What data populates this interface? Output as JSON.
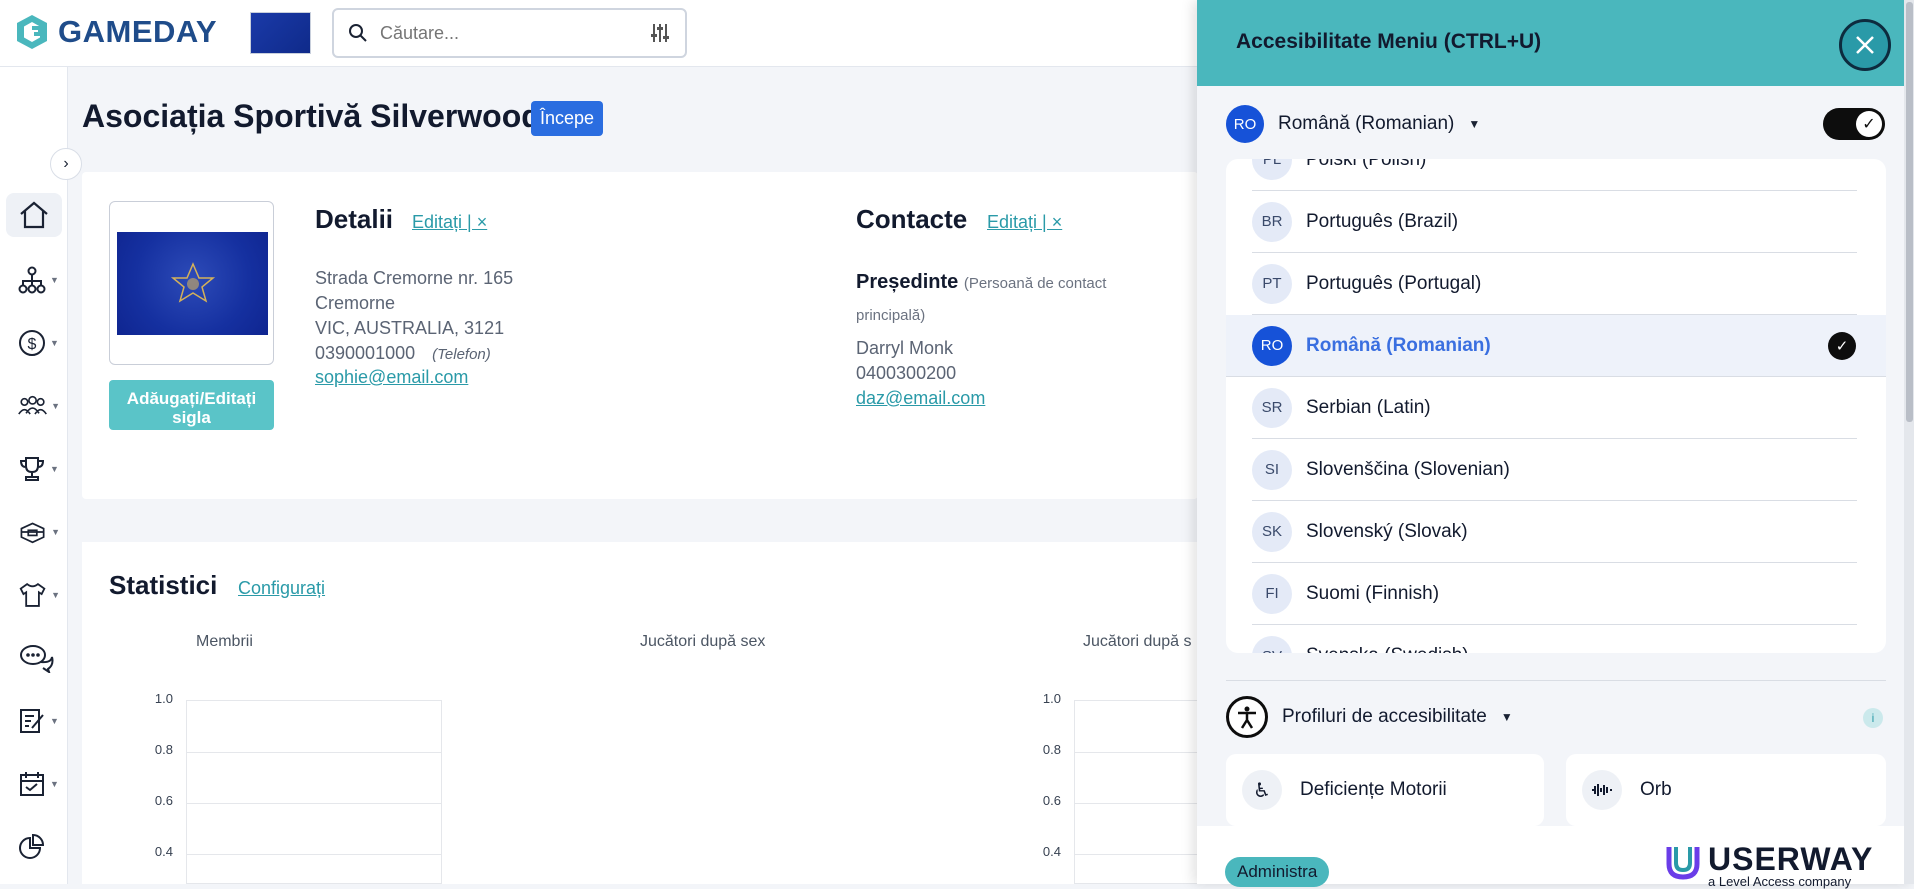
{
  "app": {
    "brand": "GAMEDAY"
  },
  "search": {
    "placeholder": "Căutare..."
  },
  "page": {
    "title": "Asociația Sportivă Silverwood",
    "start_badge": "Începe"
  },
  "details": {
    "title": "Detalii",
    "edit": "Editați | ×",
    "address": [
      "Strada Cremorne nr. 165",
      "Cremorne",
      "VIC, AUSTRALIA, 3121"
    ],
    "phone": "0390001000",
    "phone_label": "(Telefon)",
    "email": "sophie@email.com",
    "logo_button": "Adăugați/Editați sigla"
  },
  "contacts": {
    "title": "Contacte",
    "edit": "Editați | ×",
    "role": "Președinte",
    "role_note": "(Persoană de contact principală)",
    "name": "Darryl Monk",
    "phone": "0400300200",
    "email": "daz@email.com"
  },
  "stats": {
    "title": "Statistici",
    "config": "Configurați",
    "charts": [
      "Membrii",
      "Jucători după sex",
      "Jucători după s"
    ],
    "yticks": [
      "1.0",
      "0.8",
      "0.6",
      "0.4"
    ]
  },
  "panel": {
    "title": "Accesibilitate Meniu (CTRL+U)",
    "current_code": "RO",
    "current_lang": "Română (Romanian)",
    "languages": [
      {
        "code": "PL",
        "name": "Polski (Polish)",
        "selected": false
      },
      {
        "code": "BR",
        "name": "Português (Brazil)",
        "selected": false
      },
      {
        "code": "PT",
        "name": "Português (Portugal)",
        "selected": false
      },
      {
        "code": "RO",
        "name": "Română (Romanian)",
        "selected": true
      },
      {
        "code": "SR",
        "name": "Serbian (Latin)",
        "selected": false
      },
      {
        "code": "SI",
        "name": "Slovenščina (Slovenian)",
        "selected": false
      },
      {
        "code": "SK",
        "name": "Slovenský (Slovak)",
        "selected": false
      },
      {
        "code": "FI",
        "name": "Suomi (Finnish)",
        "selected": false
      },
      {
        "code": "SV",
        "name": "Svenska (Swedish)",
        "selected": false
      }
    ],
    "profiles_label": "Profiluri de accesibilitate",
    "profile_cards": [
      "Deficiențe Motorii",
      "Orb"
    ],
    "admin_badge": "Administra",
    "userway": "USERWAY",
    "userway_sub": "a Level Access company"
  },
  "colors": {
    "accent": "#4ab7bd",
    "primary": "#1652d8",
    "link": "#2a9aa8"
  },
  "sidebar_icons": [
    "home-icon",
    "org-chart-icon",
    "dollar-icon",
    "members-icon",
    "trophy-icon",
    "venue-icon",
    "jersey-icon",
    "chat-icon",
    "form-icon",
    "calendar-icon",
    "reports-icon"
  ]
}
